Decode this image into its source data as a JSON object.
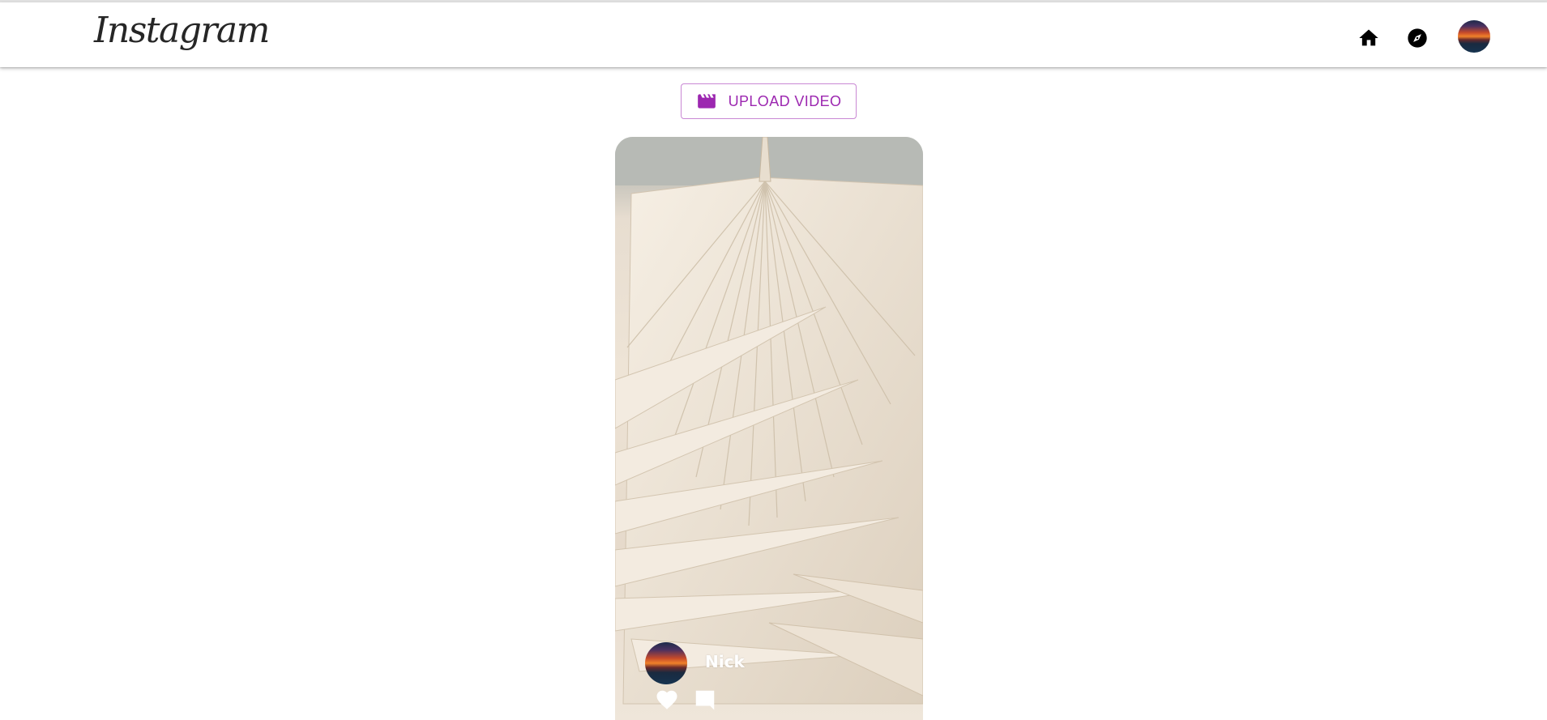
{
  "app": {
    "logo_text": "Instagram",
    "accent_color": "#9c27b0"
  },
  "nav": {
    "items": [
      {
        "name": "home-icon"
      },
      {
        "name": "explore-compass-icon"
      },
      {
        "name": "profile-avatar"
      }
    ]
  },
  "upload": {
    "label": "UPLOAD VIDEO",
    "icon": "movie-clapperboard-icon"
  },
  "post": {
    "username": "Nick",
    "actions": [
      "heart-icon",
      "comment-icon"
    ]
  }
}
